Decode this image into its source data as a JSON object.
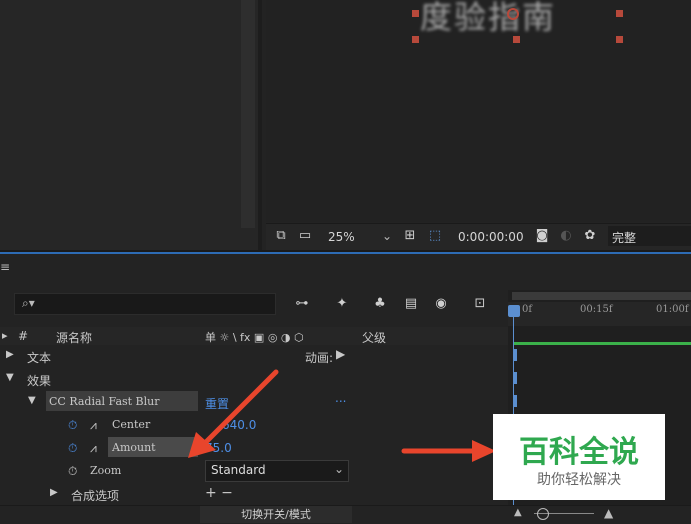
{
  "viewer": {
    "blur_text": "度验指南",
    "zoom": "25%",
    "timecode": "0:00:00:00",
    "resolution": "完整"
  },
  "timeline": {
    "columns": {
      "source_name": "源名称",
      "hash": "#",
      "switch_icons": "单 ☼ \\ fx ▣ ◎ ◑ ⬡",
      "parent": "父级"
    },
    "ruler": {
      "t0": "0f",
      "t1": "00:15f",
      "t2": "01:00f"
    },
    "rows": {
      "text_label": "文本",
      "animate_label": "动画:",
      "effects_label": "效果",
      "effect_name": "CC Radial Fast Blur",
      "reset_label": "重置",
      "reset_dots": "...",
      "center_label": "Center",
      "center_value": "640.0",
      "amount_label": "Amount",
      "amount_value": "75.0",
      "zoom_label": "Zoom",
      "zoom_value": "Standard",
      "comp_options_label": "合成选项",
      "comp_options_controls": "+ −"
    },
    "toggle_mode": "切换开关/模式"
  },
  "watermark": {
    "title": "百科全说",
    "subtitle": "助你轻松解决"
  },
  "colors": {
    "accent_blue": "#4e8fe6",
    "handle_red": "#b7493b",
    "watermark_green": "#2fa84f",
    "arrow_red": "#e8452c"
  }
}
